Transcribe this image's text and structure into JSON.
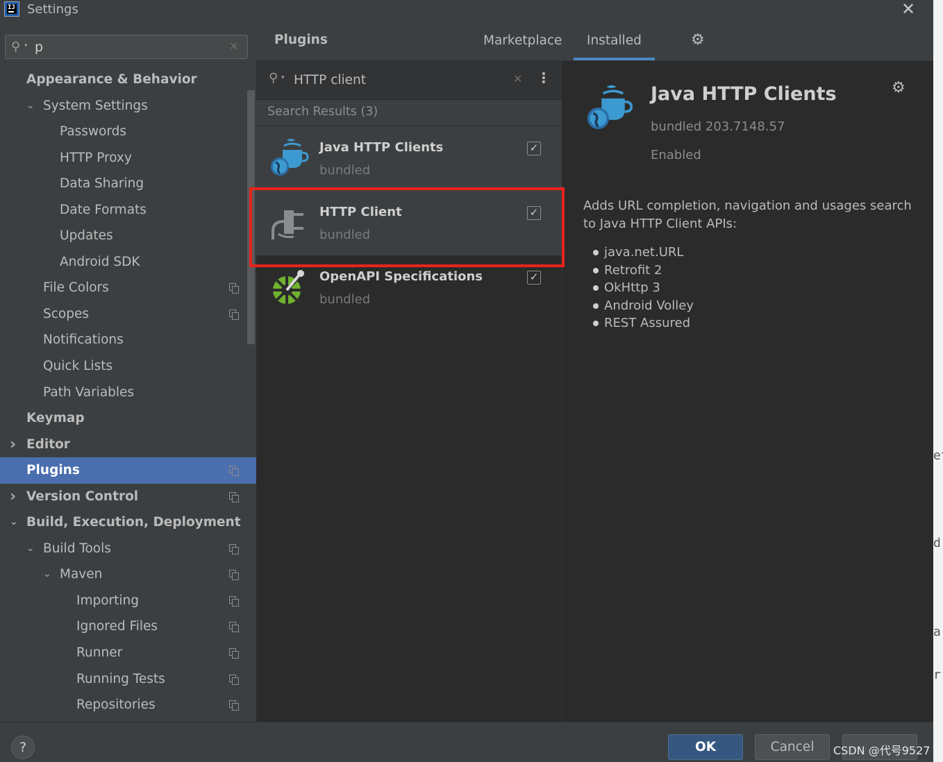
{
  "window": {
    "title": "Settings",
    "close": "✕",
    "logo": "IJ"
  },
  "sidebar": {
    "search": {
      "value": "p",
      "placeholder": ""
    },
    "items": [
      {
        "label": "Appearance & Behavior",
        "indent": 0,
        "bold": true,
        "arrow": "",
        "copy": false
      },
      {
        "label": "System Settings",
        "indent": 1,
        "bold": false,
        "arrow": "down",
        "copy": false
      },
      {
        "label": "Passwords",
        "indent": 2,
        "bold": false,
        "arrow": "",
        "copy": false
      },
      {
        "label": "HTTP Proxy",
        "indent": 2,
        "bold": false,
        "arrow": "",
        "copy": false
      },
      {
        "label": "Data Sharing",
        "indent": 2,
        "bold": false,
        "arrow": "",
        "copy": false
      },
      {
        "label": "Date Formats",
        "indent": 2,
        "bold": false,
        "arrow": "",
        "copy": false
      },
      {
        "label": "Updates",
        "indent": 2,
        "bold": false,
        "arrow": "",
        "copy": false
      },
      {
        "label": "Android SDK",
        "indent": 2,
        "bold": false,
        "arrow": "",
        "copy": false
      },
      {
        "label": "File Colors",
        "indent": 1,
        "bold": false,
        "arrow": "",
        "copy": true
      },
      {
        "label": "Scopes",
        "indent": 1,
        "bold": false,
        "arrow": "",
        "copy": true
      },
      {
        "label": "Notifications",
        "indent": 1,
        "bold": false,
        "arrow": "",
        "copy": false
      },
      {
        "label": "Quick Lists",
        "indent": 1,
        "bold": false,
        "arrow": "",
        "copy": false
      },
      {
        "label": "Path Variables",
        "indent": 1,
        "bold": false,
        "arrow": "",
        "copy": false
      },
      {
        "label": "Keymap",
        "indent": 0,
        "bold": true,
        "arrow": "",
        "copy": false
      },
      {
        "label": "Editor",
        "indent": 0,
        "bold": true,
        "arrow": "right",
        "copy": false
      },
      {
        "label": "Plugins",
        "indent": 0,
        "bold": true,
        "arrow": "",
        "copy": true,
        "selected": true
      },
      {
        "label": "Version Control",
        "indent": 0,
        "bold": true,
        "arrow": "right",
        "copy": true
      },
      {
        "label": "Build, Execution, Deployment",
        "indent": 0,
        "bold": true,
        "arrow": "down",
        "copy": false
      },
      {
        "label": "Build Tools",
        "indent": 1,
        "bold": false,
        "arrow": "down",
        "copy": true
      },
      {
        "label": "Maven",
        "indent": 2,
        "bold": false,
        "arrow": "down",
        "copy": true
      },
      {
        "label": "Importing",
        "indent": 3,
        "bold": false,
        "arrow": "",
        "copy": true
      },
      {
        "label": "Ignored Files",
        "indent": 3,
        "bold": false,
        "arrow": "",
        "copy": true
      },
      {
        "label": "Runner",
        "indent": 3,
        "bold": false,
        "arrow": "",
        "copy": true
      },
      {
        "label": "Running Tests",
        "indent": 3,
        "bold": false,
        "arrow": "",
        "copy": true
      },
      {
        "label": "Repositories",
        "indent": 3,
        "bold": false,
        "arrow": "",
        "copy": true
      }
    ]
  },
  "main": {
    "title": "Plugins",
    "tabs": [
      {
        "label": "Marketplace",
        "active": false
      },
      {
        "label": "Installed",
        "active": true
      }
    ],
    "search": {
      "value": "HTTP client"
    },
    "results_label": "Search Results (3)",
    "plugins": [
      {
        "name": "Java HTTP Clients",
        "subtitle": "bundled",
        "checked": true,
        "icon": "java-http-clients-icon",
        "selected": true
      },
      {
        "name": "HTTP Client",
        "subtitle": "bundled",
        "checked": true,
        "icon": "plug-icon",
        "highlighted": true
      },
      {
        "name": "OpenAPI Specifications",
        "subtitle": "bundled",
        "checked": true,
        "icon": "openapi-icon"
      }
    ]
  },
  "details": {
    "name": "Java HTTP Clients",
    "version": "bundled 203.7148.57",
    "status": "Enabled",
    "description": "Adds URL completion, navigation and usages search to Java HTTP Client APIs:",
    "features": [
      "java.net.URL",
      "Retrofit 2",
      "OkHttp 3",
      "Android Volley",
      "REST Assured"
    ]
  },
  "footer": {
    "help": "?",
    "ok": "OK",
    "cancel": "Cancel",
    "apply": ""
  },
  "watermark": "CSDN @代号9527",
  "background_strip": [
    "et",
    "d",
    "a",
    "r"
  ],
  "colors": {
    "accent": "#4b6eaf",
    "highlight": "#e8241c",
    "ok_button": "#365880"
  }
}
